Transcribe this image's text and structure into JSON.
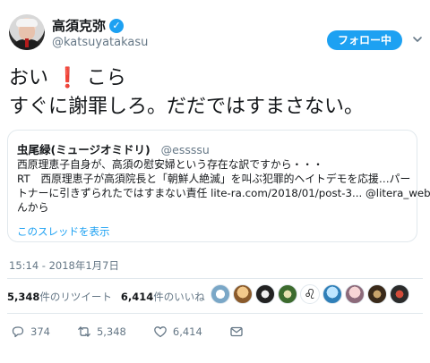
{
  "author": {
    "display_name": "高須克弥",
    "handle": "@katsuyatakasu"
  },
  "follow_button_label": "フォロー中",
  "tweet": {
    "line1_part1": "おい",
    "line1_part2": "こら",
    "line2": "すぐに謝罪しろ。だだではすまさない。"
  },
  "quoted": {
    "display_name": "虫尾緑(ミュージオミドリ)",
    "handle": "@essssu",
    "lines": [
      "西原理恵子自身が、高須の慰安婦という存在な訳ですから・・・",
      "RT　西原理恵子が高須院長と「朝鮮人絶滅」を叫ぶ犯罪的ヘイトデモを応援…パー",
      "トナーに引きずられたではすまない責任 lite-ra.com/2018/01/post-3... @litera_webさ",
      "んから"
    ],
    "show_thread_label": "このスレッドを表示"
  },
  "timestamp": "15:14 - 2018年1月7日",
  "stats": {
    "retweets_count": "5,348",
    "retweets_label": "件のリツイート",
    "likes_count": "6,414",
    "likes_label": "件のいいね"
  },
  "actions": {
    "reply_count": "374",
    "retweet_count": "5,348",
    "like_count": "6,414"
  },
  "colors": {
    "accent": "#1da1f2",
    "text": "#14171a",
    "muted": "#657786",
    "border": "#e1e8ed"
  }
}
